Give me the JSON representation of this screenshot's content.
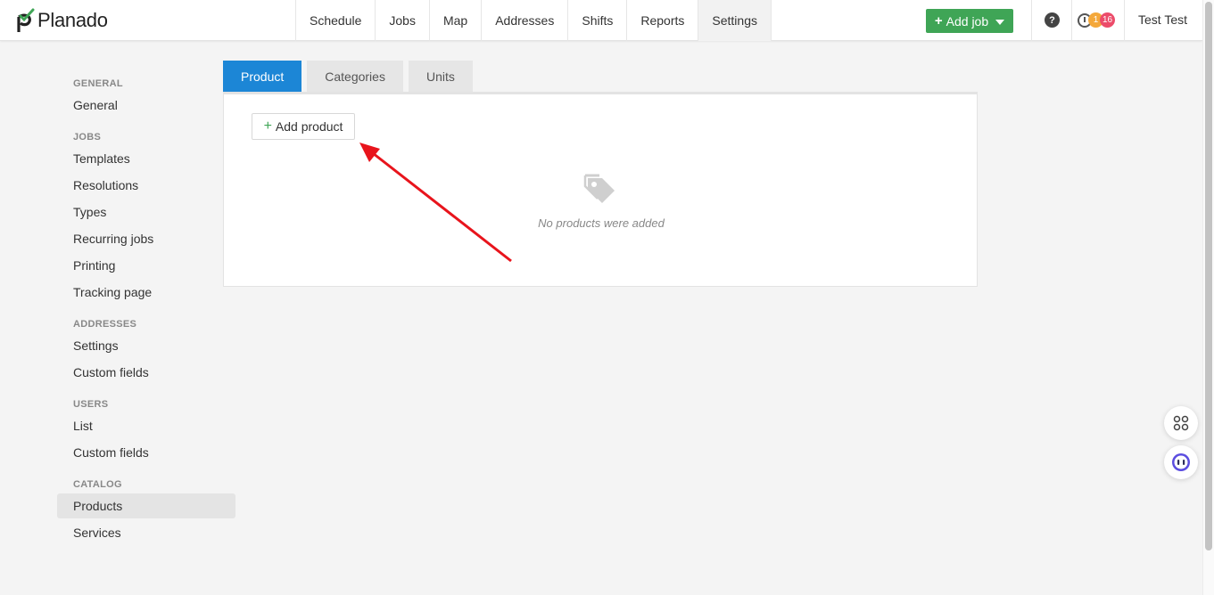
{
  "app": {
    "brand": "Planado"
  },
  "nav": {
    "items": [
      {
        "label": "Schedule"
      },
      {
        "label": "Jobs"
      },
      {
        "label": "Map"
      },
      {
        "label": "Addresses"
      },
      {
        "label": "Shifts"
      },
      {
        "label": "Reports"
      },
      {
        "label": "Settings",
        "active": true
      }
    ]
  },
  "header": {
    "add_job_label": "Add job",
    "help_glyph": "?",
    "notifications": {
      "count_orange": "1",
      "count_red": "16"
    },
    "user_name": "Test Test"
  },
  "sidebar": {
    "sections": [
      {
        "heading": "GENERAL",
        "items": [
          "General"
        ]
      },
      {
        "heading": "JOBS",
        "items": [
          "Templates",
          "Resolutions",
          "Types",
          "Recurring jobs",
          "Printing",
          "Tracking page"
        ]
      },
      {
        "heading": "ADDRESSES",
        "items": [
          "Settings",
          "Custom fields"
        ]
      },
      {
        "heading": "USERS",
        "items": [
          "List",
          "Custom fields"
        ]
      },
      {
        "heading": "CATALOG",
        "items": [
          "Products",
          "Services"
        ]
      }
    ],
    "active_item": "Products"
  },
  "tabs": [
    {
      "label": "Product",
      "active": true
    },
    {
      "label": "Categories"
    },
    {
      "label": "Units"
    }
  ],
  "panel": {
    "add_product_label": "Add product",
    "empty_message": "No products were added"
  },
  "colors": {
    "brand_green": "#3fa556",
    "tab_active": "#1c86d6",
    "annotation_arrow": "#e8141c"
  },
  "icons": [
    "planado-logo-icon",
    "help-icon",
    "clock-icon",
    "tags-icon",
    "apps-grid-icon",
    "chat-bot-icon"
  ]
}
